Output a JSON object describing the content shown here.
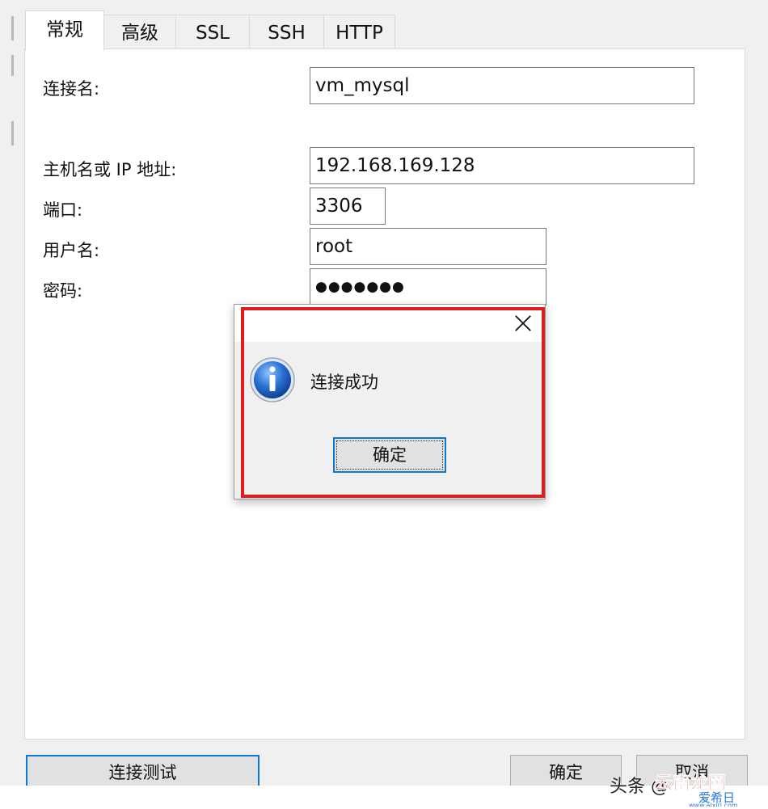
{
  "tabs": [
    {
      "label": "常规",
      "active": true
    },
    {
      "label": "高级"
    },
    {
      "label": "SSL"
    },
    {
      "label": "SSH"
    },
    {
      "label": "HTTP"
    }
  ],
  "form": {
    "connection_name": {
      "label": "连接名:",
      "value": "vm_mysql"
    },
    "host": {
      "label": "主机名或 IP 地址:",
      "value": "192.168.169.128"
    },
    "port": {
      "label": "端口:",
      "value": "3306"
    },
    "username": {
      "label": "用户名:",
      "value": "root"
    },
    "password": {
      "label": "密码:",
      "value": "●●●●●●●"
    }
  },
  "dialog": {
    "message": "连接成功",
    "ok_label": "确定",
    "icon": "info-icon",
    "highlight_color": "#e11c1c"
  },
  "buttons": {
    "test_label": "连接测试",
    "ok_label": "确定",
    "cancel_label": "取消"
  },
  "watermark": {
    "text": "头条 @",
    "logo_text": "云南龙网",
    "site_name": "爱希日",
    "site_url": "www.aixiri.com"
  },
  "colors": {
    "accent": "#0a78d7",
    "highlight": "#e11c1c"
  }
}
